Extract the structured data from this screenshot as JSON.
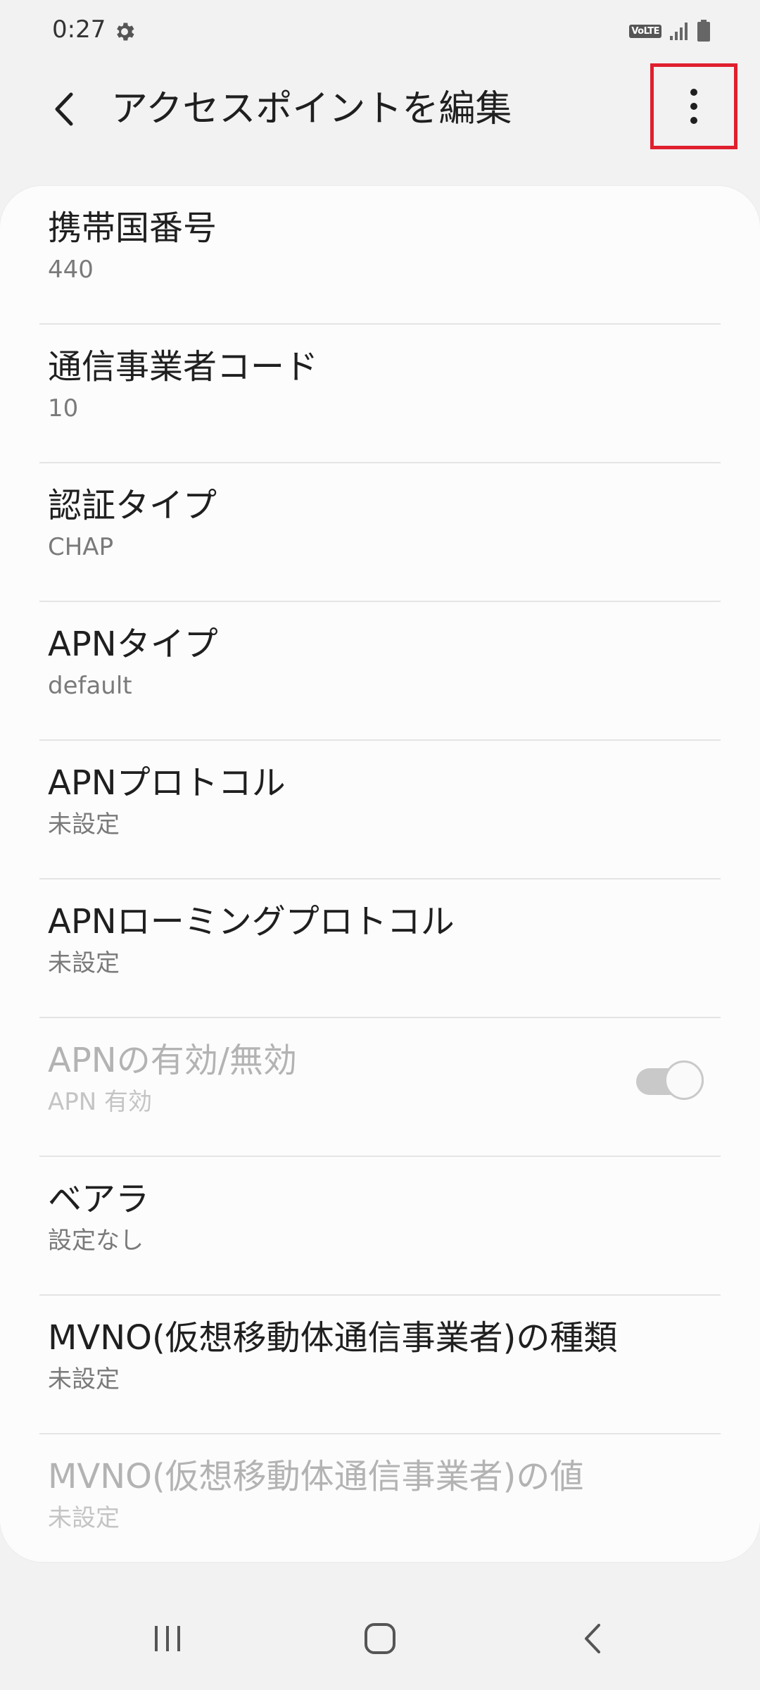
{
  "status_bar": {
    "time": "0:27",
    "settings_icon": "gear-icon",
    "volte": "VoLTE",
    "signal_icon": "signal-icon",
    "battery_icon": "battery-icon"
  },
  "app_bar": {
    "back_icon": "chevron-left-icon",
    "title": "アクセスポイントを編集",
    "more_icon": "more-vertical-icon",
    "highlight_color": "#e0202e"
  },
  "settings": [
    {
      "title": "携帯国番号",
      "value": "440",
      "enabled": true
    },
    {
      "title": "通信事業者コード",
      "value": "10",
      "enabled": true
    },
    {
      "title": "認証タイプ",
      "value": "CHAP",
      "enabled": true
    },
    {
      "title": "APNタイプ",
      "value": "default",
      "enabled": true
    },
    {
      "title": "APNプロトコル",
      "value": "未設定",
      "enabled": true
    },
    {
      "title": "APNローミングプロトコル",
      "value": "未設定",
      "enabled": true
    },
    {
      "title": "APNの有効/無効",
      "value": "APN 有効",
      "enabled": false,
      "toggle_on": true
    },
    {
      "title": "ベアラ",
      "value": "設定なし",
      "enabled": true
    },
    {
      "title": "MVNO(仮想移動体通信事業者)の種類",
      "value": "未設定",
      "enabled": true
    },
    {
      "title": "MVNO(仮想移動体通信事業者)の値",
      "value": "未設定",
      "enabled": false
    }
  ],
  "nav_bar": {
    "recents_icon": "recents-icon",
    "home_icon": "home-icon",
    "back_icon": "back-icon"
  }
}
